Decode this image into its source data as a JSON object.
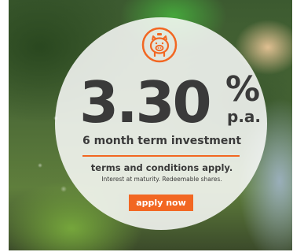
{
  "ad": {
    "rate": "3.30",
    "percent_sign": "%",
    "per_annum": "p.a.",
    "term": "6 month term investment",
    "terms_notice": "terms and conditions apply.",
    "fine_print": "Interest at maturity. Redeemable shares.",
    "cta_label": "apply now",
    "logo_icon": "piggy-bank-icon"
  },
  "colors": {
    "accent": "#f26722",
    "text": "#3a3a3a",
    "cta_text": "#ffffff"
  }
}
